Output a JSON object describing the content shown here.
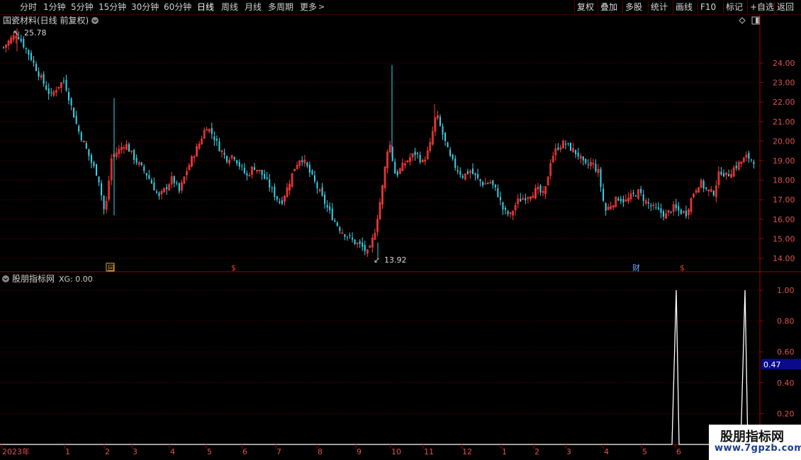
{
  "toolbar": {
    "periods": [
      "分时",
      "1分钟",
      "5分钟",
      "15分钟",
      "30分钟",
      "60分钟",
      "日线",
      "周线",
      "月线",
      "多周期",
      "更多"
    ],
    "active_period": "日线",
    "right_buttons": [
      "复权",
      "叠加",
      "多股",
      "统计",
      "画线",
      "F10",
      "标记",
      "+自选",
      "返回"
    ]
  },
  "main_panel": {
    "title": "国瓷材料(日线 前复权)",
    "high_label": "25.78",
    "low_label": "13.92",
    "markers": [
      {
        "label": "回",
        "color": "#e8a84c",
        "x_index": "2023-02"
      },
      {
        "label": "$",
        "color": "#ff3030",
        "x_index": "2023-05"
      },
      {
        "label": "财",
        "color": "#6aa8ff",
        "x_index": "2024-04"
      },
      {
        "label": "$",
        "color": "#ff3030",
        "x_index": "2024-05"
      }
    ]
  },
  "sub_panel": {
    "title": "股朋指标网",
    "xg_label": "XG: 0.00",
    "cursor_value": "0.47"
  },
  "x_axis": {
    "labels": [
      "2023年",
      "1",
      "2",
      "3",
      "4",
      "5",
      "6",
      "7",
      "8",
      "9",
      "10",
      "11",
      "12",
      "1",
      "2",
      "3",
      "4",
      "5",
      "6"
    ]
  },
  "watermark": {
    "line1": "股朋指标网",
    "line2": "www.7gpzb.com"
  },
  "colors": {
    "up": "#ff3b3b",
    "down": "#39d4e8",
    "grid": "#7a0000",
    "axis_text": "#e05050",
    "signal": "#ffffff"
  },
  "chart_data": [
    {
      "type": "candlestick",
      "title": "国瓷材料(日线 前复权)",
      "y_ticks": [
        "14.00",
        "15.00",
        "16.00",
        "17.00",
        "18.00",
        "19.00",
        "20.00",
        "21.00",
        "22.00",
        "23.00",
        "24.00"
      ],
      "ylim": [
        13.5,
        25.9
      ],
      "max": 25.78,
      "min": 13.92,
      "close_path_weekly": [
        [
          0,
          24.8
        ],
        [
          1,
          25.2
        ],
        [
          2,
          25.5
        ],
        [
          3,
          24.9
        ],
        [
          4,
          24.3
        ],
        [
          5,
          23.6
        ],
        [
          6,
          22.9
        ],
        [
          7,
          22.3
        ],
        [
          8,
          22.8
        ],
        [
          9,
          23.1
        ],
        [
          10,
          21.8
        ],
        [
          11,
          20.6
        ],
        [
          12,
          19.8
        ],
        [
          13,
          18.9
        ],
        [
          14,
          18.2
        ],
        [
          15,
          16.2
        ],
        [
          16,
          19.2
        ],
        [
          17,
          19.5
        ],
        [
          18,
          19.9
        ],
        [
          19,
          19.3
        ],
        [
          20,
          18.8
        ],
        [
          21,
          18.4
        ],
        [
          22,
          17.8
        ],
        [
          23,
          17.1
        ],
        [
          24,
          17.6
        ],
        [
          25,
          18.1
        ],
        [
          26,
          17.4
        ],
        [
          27,
          18.4
        ],
        [
          28,
          19.2
        ],
        [
          29,
          19.9
        ],
        [
          30,
          20.8
        ],
        [
          31,
          20.3
        ],
        [
          32,
          19.6
        ],
        [
          33,
          19.1
        ],
        [
          34,
          19.3
        ],
        [
          35,
          18.7
        ],
        [
          36,
          18.2
        ],
        [
          37,
          18.7
        ],
        [
          38,
          18.4
        ],
        [
          39,
          17.9
        ],
        [
          40,
          17.3
        ],
        [
          41,
          16.8
        ],
        [
          42,
          17.6
        ],
        [
          43,
          18.6
        ],
        [
          44,
          19.2
        ],
        [
          45,
          18.6
        ],
        [
          46,
          17.9
        ],
        [
          47,
          17.2
        ],
        [
          48,
          16.5
        ],
        [
          49,
          15.9
        ],
        [
          50,
          15.4
        ],
        [
          51,
          15.1
        ],
        [
          52,
          14.8
        ],
        [
          53,
          14.6
        ],
        [
          54,
          14.2
        ],
        [
          55,
          15.5
        ],
        [
          56,
          17.5
        ],
        [
          57,
          20.1
        ],
        [
          58,
          18.2
        ],
        [
          59,
          18.7
        ],
        [
          60,
          19.1
        ],
        [
          61,
          19.4
        ],
        [
          62,
          18.9
        ],
        [
          63,
          19.6
        ],
        [
          64,
          21.4
        ],
        [
          65,
          20.3
        ],
        [
          66,
          19.2
        ],
        [
          67,
          18.6
        ],
        [
          68,
          18.2
        ],
        [
          69,
          18.5
        ],
        [
          70,
          18.1
        ],
        [
          71,
          17.8
        ],
        [
          72,
          17.9
        ],
        [
          73,
          17.4
        ],
        [
          74,
          16.4
        ],
        [
          75,
          16.2
        ],
        [
          76,
          16.9
        ],
        [
          77,
          17.1
        ],
        [
          78,
          17.3
        ],
        [
          79,
          17.5
        ],
        [
          80,
          17.2
        ],
        [
          81,
          19.1
        ],
        [
          82,
          19.7
        ],
        [
          83,
          19.9
        ],
        [
          84,
          19.6
        ],
        [
          85,
          19.3
        ],
        [
          86,
          18.7
        ],
        [
          87,
          18.9
        ],
        [
          88,
          18.4
        ],
        [
          89,
          16.4
        ],
        [
          90,
          16.8
        ],
        [
          91,
          17.1
        ],
        [
          92,
          16.9
        ],
        [
          93,
          17.2
        ],
        [
          94,
          17.4
        ],
        [
          95,
          16.9
        ],
        [
          96,
          16.6
        ],
        [
          97,
          16.4
        ],
        [
          98,
          16.2
        ],
        [
          99,
          16.6
        ],
        [
          100,
          16.4
        ],
        [
          101,
          16.3
        ],
        [
          102,
          17.3
        ],
        [
          103,
          17.9
        ],
        [
          104,
          17.5
        ],
        [
          105,
          17.3
        ],
        [
          106,
          18.5
        ],
        [
          107,
          18.2
        ],
        [
          108,
          18.6
        ],
        [
          109,
          18.9
        ],
        [
          110,
          19.2
        ],
        [
          111,
          19.0
        ]
      ]
    },
    {
      "type": "line",
      "title": "股朋指标网",
      "series": [
        {
          "name": "XG",
          "values": [
            0,
            0,
            1,
            0,
            0,
            1,
            0
          ]
        }
      ],
      "x_index": [
        "2024-05",
        "2024-06 early",
        "2024-06",
        "2024-06 late",
        "2024-07",
        "2024-07 mid",
        "end"
      ],
      "y_ticks": [
        "0.20",
        "0.40",
        "0.60",
        "0.80",
        "1.00"
      ],
      "ylim": [
        0,
        1.05
      ]
    }
  ]
}
